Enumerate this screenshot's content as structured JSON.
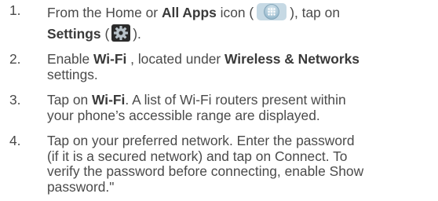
{
  "steps": [
    {
      "number": "1.",
      "line1": {
        "t1": "From the Home or ",
        "b1": "All Apps",
        "t2": " icon (",
        "t3": "), tap on"
      },
      "line2": {
        "b1": "Settings",
        "t1": " (",
        "t2": ")."
      }
    },
    {
      "number": "2.",
      "line1": {
        "t1": "Enable ",
        "b1": "Wi-Fi",
        "t2": " , located under ",
        "b2": "Wireless & Networks"
      },
      "line2": "settings."
    },
    {
      "number": "3.",
      "line1": {
        "t1": "Tap on ",
        "b1": "Wi-Fi",
        "t2": ". A list of Wi-Fi routers present within"
      },
      "line2": "your phone’s accessible range are displayed."
    },
    {
      "number": "4.",
      "lines": [
        "Tap on your preferred network. Enter the password",
        "(if it is a secured network) and tap on Connect. To",
        "verify the password before connecting, enable Show",
        "password.\""
      ]
    }
  ],
  "icons": {
    "all_apps": "all-apps-icon",
    "settings": "settings-gear-icon",
    "colors": {
      "apps_bg": "#8fb4c9",
      "apps_grid": "#ffffff",
      "settings_bg": "#2b2b2b",
      "settings_gear": "#b9c3ca"
    }
  }
}
